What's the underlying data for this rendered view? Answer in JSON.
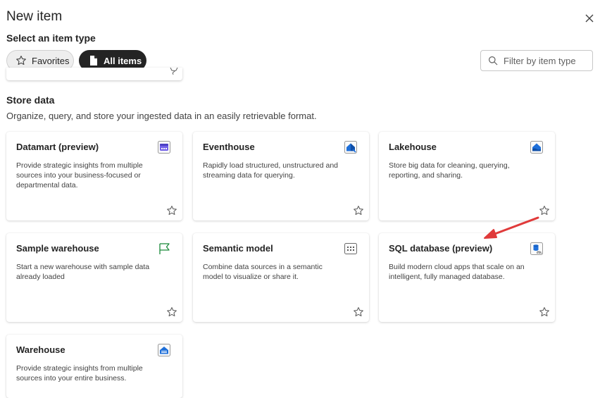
{
  "dialog": {
    "title": "New item",
    "subtitle": "Select an item type"
  },
  "filters": {
    "favorites_label": "Favorites",
    "all_items_label": "All items",
    "search_placeholder": "Filter by item type"
  },
  "section": {
    "title": "Store data",
    "description": "Organize, query, and store your ingested data in an easily retrievable format."
  },
  "cards": [
    {
      "title": "Datamart (preview)",
      "description": "Provide strategic insights from multiple sources into your business-focused or departmental data.",
      "icon": "datamart-icon"
    },
    {
      "title": "Eventhouse",
      "description": "Rapidly load structured, unstructured and streaming data for querying.",
      "icon": "eventhouse-icon"
    },
    {
      "title": "Lakehouse",
      "description": "Store big data for cleaning, querying, reporting, and sharing.",
      "icon": "lakehouse-icon"
    },
    {
      "title": "Sample warehouse",
      "description": "Start a new warehouse with sample data already loaded",
      "icon": "flag-icon"
    },
    {
      "title": "Semantic model",
      "description": "Combine data sources in a semantic model to visualize or share it.",
      "icon": "semantic-model-icon"
    },
    {
      "title": "SQL database (preview)",
      "description": "Build modern cloud apps that scale on an intelligent, fully managed database.",
      "icon": "sql-database-icon"
    },
    {
      "title": "Warehouse",
      "description": "Provide strategic insights from multiple sources into your entire business.",
      "icon": "warehouse-icon"
    }
  ],
  "annotation": {
    "color": "#e03a3a",
    "icon": "red-arrow-annotation"
  }
}
